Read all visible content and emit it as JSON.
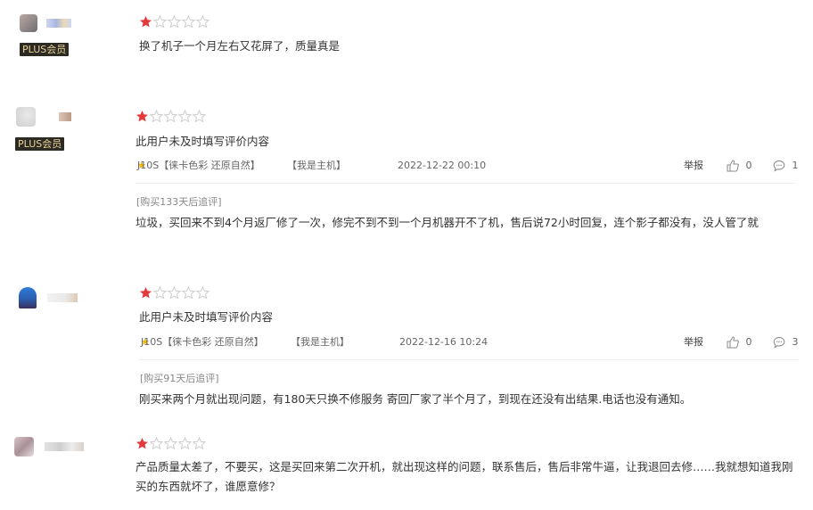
{
  "reviews": [
    {
      "badge": "PLUS会员",
      "rating": 1,
      "max_rating": 5,
      "text": "换了机子一个月左右又花屏了，质量真是"
    },
    {
      "badge": "PLUS会员",
      "rating": 1,
      "max_rating": 5,
      "text": "此用户未及时填写评价内容",
      "model": "J10S【徕卡色彩 还原自然】",
      "host_tag": "【我是主机】",
      "date": "2022-12-22 00:10",
      "report": "举报",
      "likes": "0",
      "comments": "1",
      "append_tag": "[购买133天后追评]",
      "append_text": "垃圾，买回来不到4个月返厂修了一次，修完不到不到一个月机器开不了机，售后说72小时回复，连个影子都没有，没人管了就"
    },
    {
      "rating": 1,
      "max_rating": 5,
      "text": "此用户未及时填写评价内容",
      "model": "J10S【徕卡色彩 还原自然】",
      "host_tag": "【我是主机】",
      "date": "2022-12-16 10:24",
      "report": "举报",
      "likes": "0",
      "comments": "3",
      "append_tag": "[购买91天后追评]",
      "append_text": "刚买来两个月就出现问题，有180天只换不修服务 寄回厂家了半个月了，到现在还没有出结果.电话也没有通知。"
    },
    {
      "rating": 1,
      "max_rating": 5,
      "text": "产品质量太差了，不要买，这是买回来第二次开机，就出现这样的问题，联系售后，售后非常牛逼，让我退回去修……我就想知道我刚买的东西就坏了，谁愿意修？"
    }
  ],
  "colors": {
    "star_filled": "#e4393c",
    "star_empty": "#cccccc",
    "badge_bg": "#2d2a23",
    "badge_text": "#e8d29a",
    "model_star": "#f0b400"
  }
}
